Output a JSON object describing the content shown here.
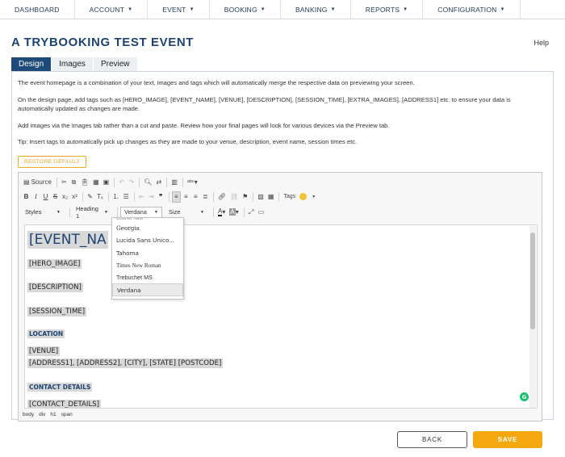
{
  "nav": {
    "items": [
      {
        "label": "DASHBOARD",
        "caret": false
      },
      {
        "label": "ACCOUNT",
        "caret": true
      },
      {
        "label": "EVENT",
        "caret": true
      },
      {
        "label": "BOOKING",
        "caret": true
      },
      {
        "label": "BANKING",
        "caret": true
      },
      {
        "label": "REPORTS",
        "caret": true
      },
      {
        "label": "CONFIGURATION",
        "caret": true
      }
    ]
  },
  "page": {
    "title": "A TRYBOOKING TEST EVENT",
    "help": "Help"
  },
  "tabs": [
    {
      "label": "Design",
      "active": true
    },
    {
      "label": "Images",
      "active": false
    },
    {
      "label": "Preview",
      "active": false
    }
  ],
  "help_text": [
    "The event homepage is a combination of your text, images and tags which will automatically merge the respective data on previewing your screen.",
    "On the design page, add tags such as [HERO_IMAGE], [EVENT_NAME], [VENUE], [DESCRIPTION], [SESSION_TIME], [EXTRA_IMAGES], [ADDRESS1] etc. to ensure your data is automatically updated as changes are made.",
    "Add images via the Images tab rather than a cut and paste. Review how your final pages will look for various devices via the Preview tab.",
    "Tip: Insert tags to automatically pick up changes as they are made to your venue, description, event name, session times etc."
  ],
  "restore_label": "RESTORE DEFAULT",
  "toolbar": {
    "source_label": "Source",
    "tags_label": "Tags",
    "styles_label": "Styles",
    "format_label": "Heading 1",
    "font_label": "Verdana",
    "size_label": "Size"
  },
  "font_dropdown": {
    "partial_top": "Courier New",
    "options": [
      "Georgia",
      "Lucida Sans Unico...",
      "Tahoma",
      "Times New Roman",
      "Trebuchet MS",
      "Verdana"
    ],
    "selected": "Verdana"
  },
  "content": {
    "event_name": "[EVENT_NA",
    "hero_image": "[HERO_IMAGE]",
    "description": "[DESCRIPTION]",
    "session_time": "[SESSION_TIME]",
    "location_heading": "LOCATION",
    "venue": "[VENUE]",
    "address": "[ADDRESS1], [ADDRESS2], [CITY], [STATE] [POSTCODE]",
    "contact_heading": "CONTACT DETAILS",
    "contact_details": "[CONTACT_DETAILS]"
  },
  "path": [
    "body",
    "div",
    "h1",
    "span"
  ],
  "buttons": {
    "back": "BACK",
    "save": "SAVE"
  },
  "colors": {
    "brand_blue": "#1d4a78",
    "accent_orange": "#f5a70f"
  }
}
